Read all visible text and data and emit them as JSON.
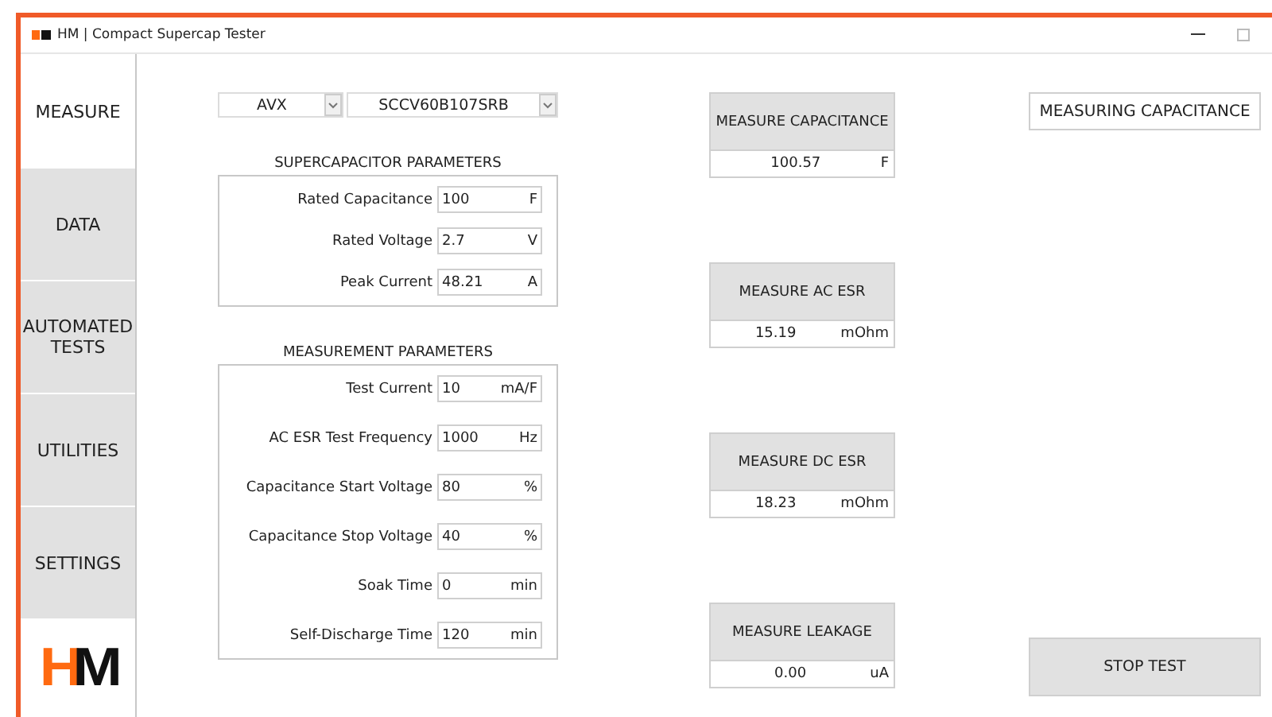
{
  "window": {
    "title": "HM | Compact Supercap Tester"
  },
  "sidebar": {
    "items": [
      {
        "label": "MEASURE",
        "selected": true
      },
      {
        "label": "DATA",
        "selected": false
      },
      {
        "label": "AUTOMATED TESTS",
        "selected": false
      },
      {
        "label": "UTILITIES",
        "selected": false
      },
      {
        "label": "SETTINGS",
        "selected": false
      }
    ],
    "logo": {
      "left": "H",
      "right": "M"
    }
  },
  "selectors": [
    {
      "value": "AVX"
    },
    {
      "value": "SCCV60B107SRB"
    }
  ],
  "sections": [
    {
      "title": "SUPERCAPACITOR PARAMETERS",
      "fields": [
        {
          "label": "Rated Capacitance",
          "value": "100",
          "unit": "F"
        },
        {
          "label": "Rated Voltage",
          "value": "2.7",
          "unit": "V"
        },
        {
          "label": "Peak Current",
          "value": "48.21",
          "unit": "A"
        }
      ]
    },
    {
      "title": "MEASUREMENT PARAMETERS",
      "fields": [
        {
          "label": "Test Current",
          "value": "10",
          "unit": "mA/F"
        },
        {
          "label": "AC ESR Test Frequency",
          "value": "1000",
          "unit": "Hz"
        },
        {
          "label": "Capacitance Start Voltage",
          "value": "80",
          "unit": "%"
        },
        {
          "label": "Capacitance Stop Voltage",
          "value": "40",
          "unit": "%"
        },
        {
          "label": "Soak Time",
          "value": "0",
          "unit": "min"
        },
        {
          "label": "Self-Discharge Time",
          "value": "120",
          "unit": "min"
        }
      ]
    }
  ],
  "measurements": [
    {
      "button": "MEASURE CAPACITANCE",
      "value": "100.57",
      "unit": "F"
    },
    {
      "button": "MEASURE AC ESR",
      "value": "15.19",
      "unit": "mOhm"
    },
    {
      "button": "MEASURE DC ESR",
      "value": "18.23",
      "unit": "mOhm"
    },
    {
      "button": "MEASURE LEAKAGE",
      "value": "0.00",
      "unit": "uA"
    }
  ],
  "status": {
    "value": "MEASURING CAPACITANCE"
  },
  "stop_button": {
    "label": "STOP TEST"
  }
}
